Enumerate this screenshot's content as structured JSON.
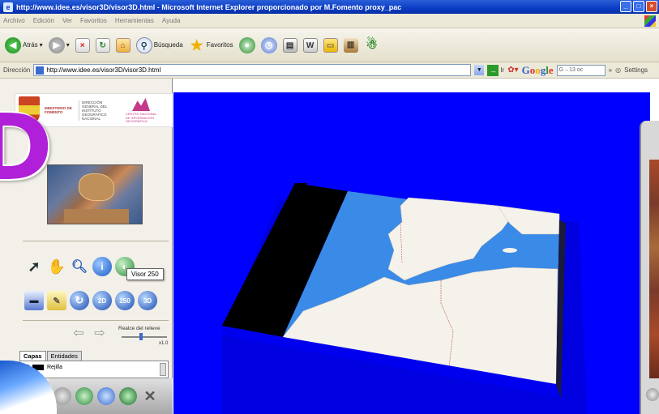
{
  "window": {
    "title": "http://www.idee.es/visor3D/visor3D.html - Microsoft Internet Explorer proporcionado por M.Fomento proxy_pac"
  },
  "menu": [
    "Archivo",
    "Edición",
    "Ver",
    "Favoritos",
    "Herramientas",
    "Ayuda"
  ],
  "toolbar": {
    "back_label": "Atrás",
    "search_label": "Búsqueda",
    "favorites_label": "Favoritos"
  },
  "address": {
    "label": "Dirección",
    "url": "http://www.idee.es/visor3D/visor3D.html",
    "go_label": "Ir",
    "google_search_text": "G→13 oc",
    "more": "»",
    "settings_label": "Settings"
  },
  "panel": {
    "ministry_text": "MINISTERIO DE FOMENTO",
    "dg_text": "DIRECCIÓN GENERAL DEL INSTITUTO GEOGRÁFICO NACIONAL",
    "ign_text": "CENTRO NACIONAL DE INFORMACIÓN GEOGRÁFICA",
    "big_letter": "D",
    "tooltip": "Visor 250",
    "btn_2d": "2D",
    "btn_250": "250",
    "btn_3d": "3D",
    "relief_label": "Realce del relieve",
    "relief_value": "x1.0",
    "tabs": [
      "Capas",
      "Entidades"
    ],
    "layers": [
      {
        "name": "Rejilla",
        "checked": false
      }
    ]
  },
  "colors": {
    "sky": "#0000ff",
    "sea": "#3a8ae8",
    "land": "#f4f2ea"
  }
}
